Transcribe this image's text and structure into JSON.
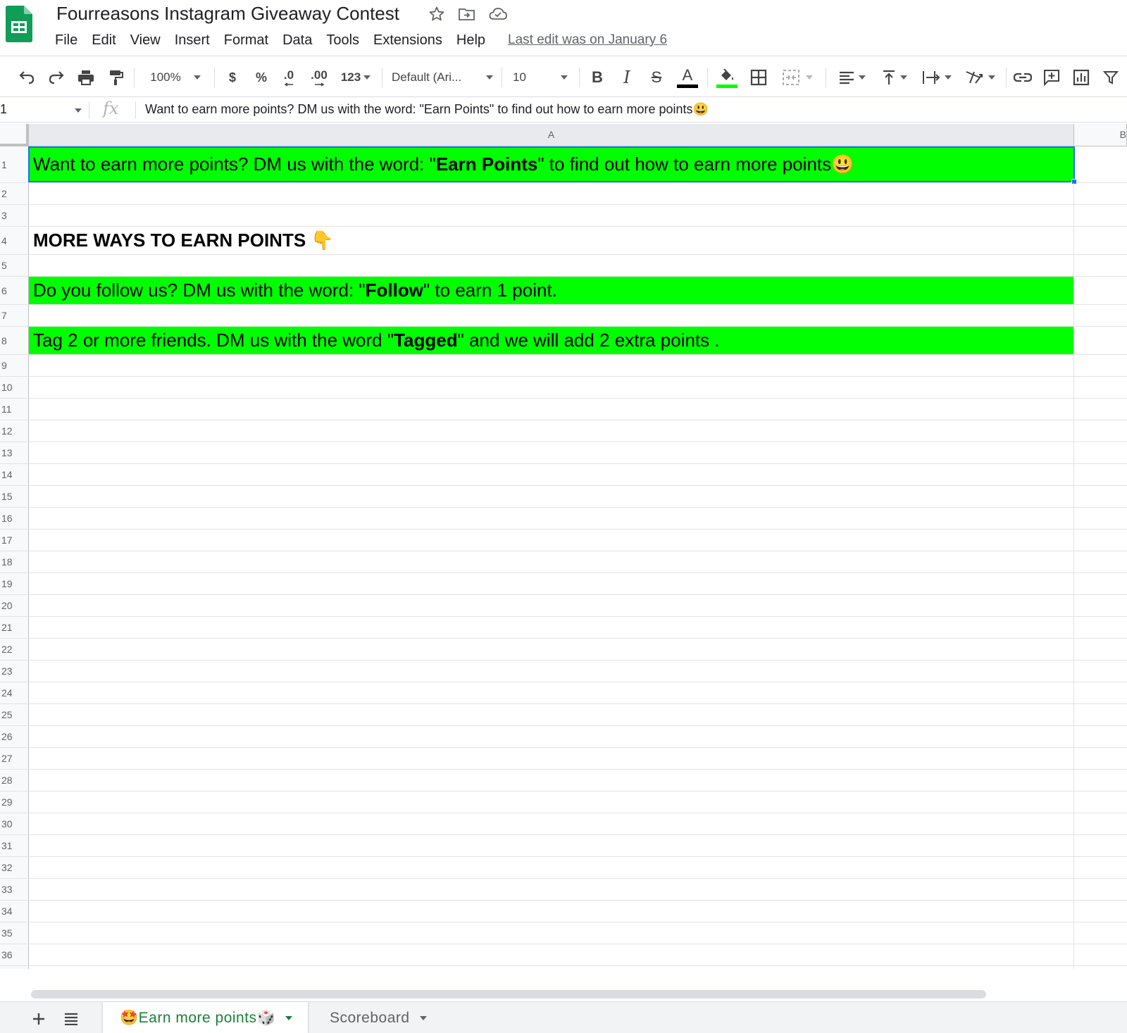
{
  "app": {
    "doc_title": "Fourreasons Instagram Giveaway Contest",
    "last_edit": "Last edit was on January 6",
    "brand_color": "#0f9d58"
  },
  "menu": [
    "File",
    "Edit",
    "View",
    "Insert",
    "Format",
    "Data",
    "Tools",
    "Extensions",
    "Help"
  ],
  "toolbar": {
    "zoom": "100%",
    "currency": "$",
    "percent": "%",
    "dec_decrease": ".0",
    "dec_increase": ".00",
    "more_formats": "123",
    "font": "Default (Ari...",
    "font_size": "10",
    "bold": "B",
    "italic": "I",
    "strike": "S",
    "text_color_label": "A",
    "text_color": "#000000",
    "fill_color": "#00ff00"
  },
  "formula_bar": {
    "name_box": "1",
    "fx": "fx",
    "content": "Want to earn more points? DM us with the word: \"Earn Points\" to find out how to earn more points😃"
  },
  "columns": [
    "A",
    "B"
  ],
  "cells": {
    "r1": {
      "pre": "Want to earn more points? DM us with the word: \"",
      "bold": "Earn Points",
      "post": "\" to find out how to earn more points😃",
      "fill": "#00ff00"
    },
    "r4": {
      "text": "MORE WAYS TO EARN POINTS 👇"
    },
    "r6": {
      "pre": "Do you follow us? DM us with the word: \"",
      "bold": "Follow",
      "post": "\" to earn 1 point.",
      "fill": "#00ff00"
    },
    "r8": {
      "pre": " Tag 2 or more friends. DM us with the word \"",
      "bold": "Tagged",
      "post": "\" and we will add 2 extra points .",
      "fill": "#00ff00"
    }
  },
  "sheets": [
    {
      "label": "🤩Earn more points🎲",
      "active": true
    },
    {
      "label": "Scoreboard",
      "active": false
    }
  ]
}
